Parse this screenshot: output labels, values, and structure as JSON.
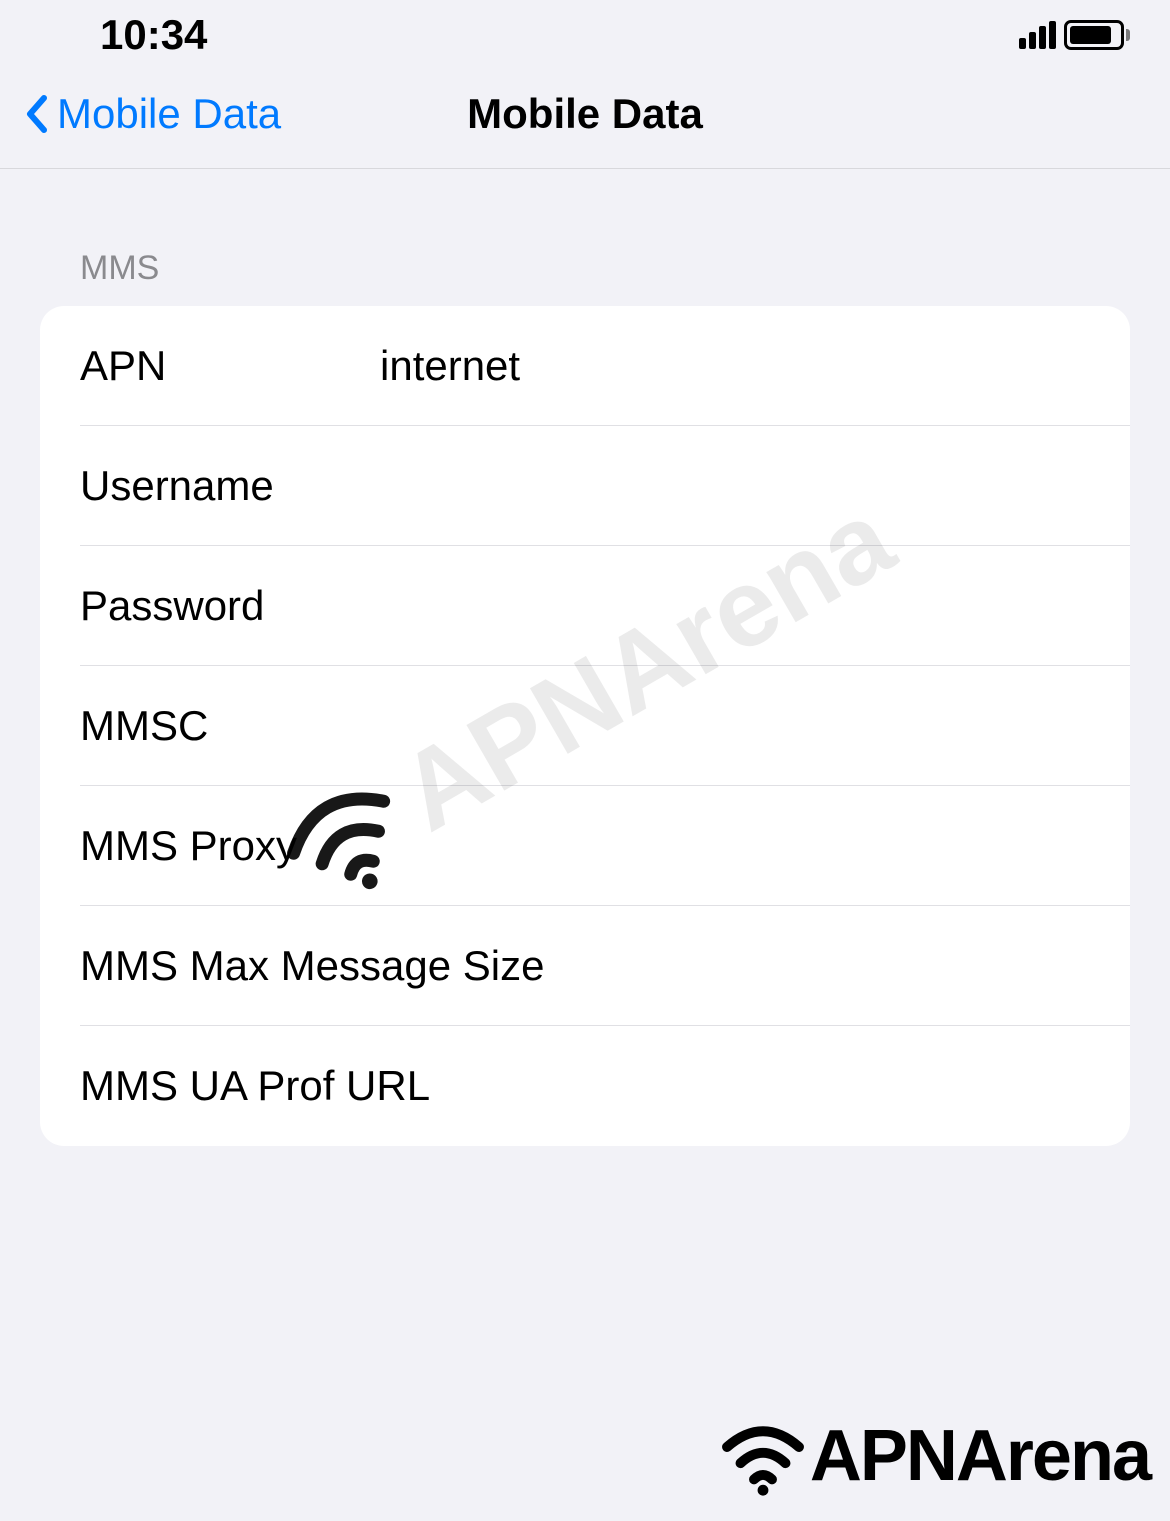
{
  "status_bar": {
    "time": "10:34"
  },
  "nav": {
    "back_label": "Mobile Data",
    "title": "Mobile Data"
  },
  "section": {
    "header": "MMS",
    "rows": [
      {
        "label": "APN",
        "value": "internet"
      },
      {
        "label": "Username",
        "value": ""
      },
      {
        "label": "Password",
        "value": ""
      },
      {
        "label": "MMSC",
        "value": ""
      },
      {
        "label": "MMS Proxy",
        "value": ""
      },
      {
        "label": "MMS Max Message Size",
        "value": ""
      },
      {
        "label": "MMS UA Prof URL",
        "value": ""
      }
    ]
  },
  "watermark": "APNArena",
  "brand": "APNArena"
}
